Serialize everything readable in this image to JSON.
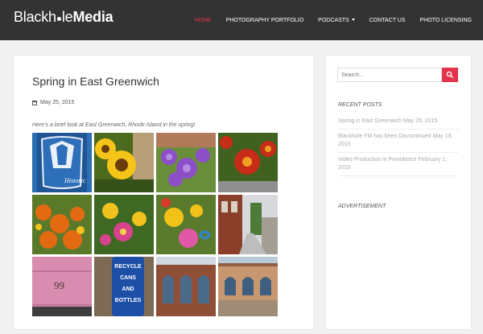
{
  "site": {
    "logo_part1": "Blackh",
    "logo_part2": "le",
    "logo_part3": "Media"
  },
  "nav": {
    "items": [
      {
        "label": "HOME",
        "active": true
      },
      {
        "label": "PHOTOGRAPHY PORTFOLIO"
      },
      {
        "label": "PODCASTS"
      },
      {
        "label": "CONTACT US"
      },
      {
        "label": "PHOTO LICENSING"
      }
    ]
  },
  "post": {
    "title": "Spring in East Greenwich",
    "date": "May 25, 2015",
    "intro": "Here's a brief look at East Greenwich, Rhode Island in the spring!",
    "gallery": {
      "tiles": [
        {
          "subject": "blue sign",
          "bg": "#2c6fb2"
        },
        {
          "subject": "sunflowers",
          "bg": "#4c6a1d"
        },
        {
          "subject": "purple petunias",
          "bg": "#6c4aa6"
        },
        {
          "subject": "red flowers",
          "bg": "#7f2b17"
        },
        {
          "subject": "orange flowers",
          "bg": "#d0641b"
        },
        {
          "subject": "yellow and pink flowers",
          "bg": "#9b3f72"
        },
        {
          "subject": "yellow flowers and ribbons",
          "bg": "#8b7a18"
        },
        {
          "subject": "main street",
          "bg": "#8a6f5a"
        },
        {
          "subject": "pink door number",
          "bg": "#d48cae"
        },
        {
          "subject": "recycle sign",
          "bg": "#1f4fa3"
        },
        {
          "subject": "brick building",
          "bg": "#9a5a41"
        },
        {
          "subject": "arched windows building",
          "bg": "#c08f66"
        }
      ],
      "texts": {
        "door_number": "99",
        "recycle_sign": [
          "RECYCLE",
          "CANS",
          "AND",
          "BOTTLES"
        ]
      }
    }
  },
  "sidebar": {
    "search": {
      "placeholder": "Search..."
    },
    "recent_posts_title": "RECENT POSTS",
    "recent_posts": [
      {
        "title": "Spring in East Greenwich",
        "date": "May 25, 2015"
      },
      {
        "title": "Blackhole FM has been Discontinued",
        "date": "May 19, 2015"
      },
      {
        "title": "Video Production in Providence",
        "date": "February 1, 2015"
      }
    ],
    "advertisement_title": "ADVERTISEMENT"
  },
  "colors": {
    "accent": "#e1334c",
    "topbar": "#333333",
    "page_bg": "#f1f1f1"
  }
}
